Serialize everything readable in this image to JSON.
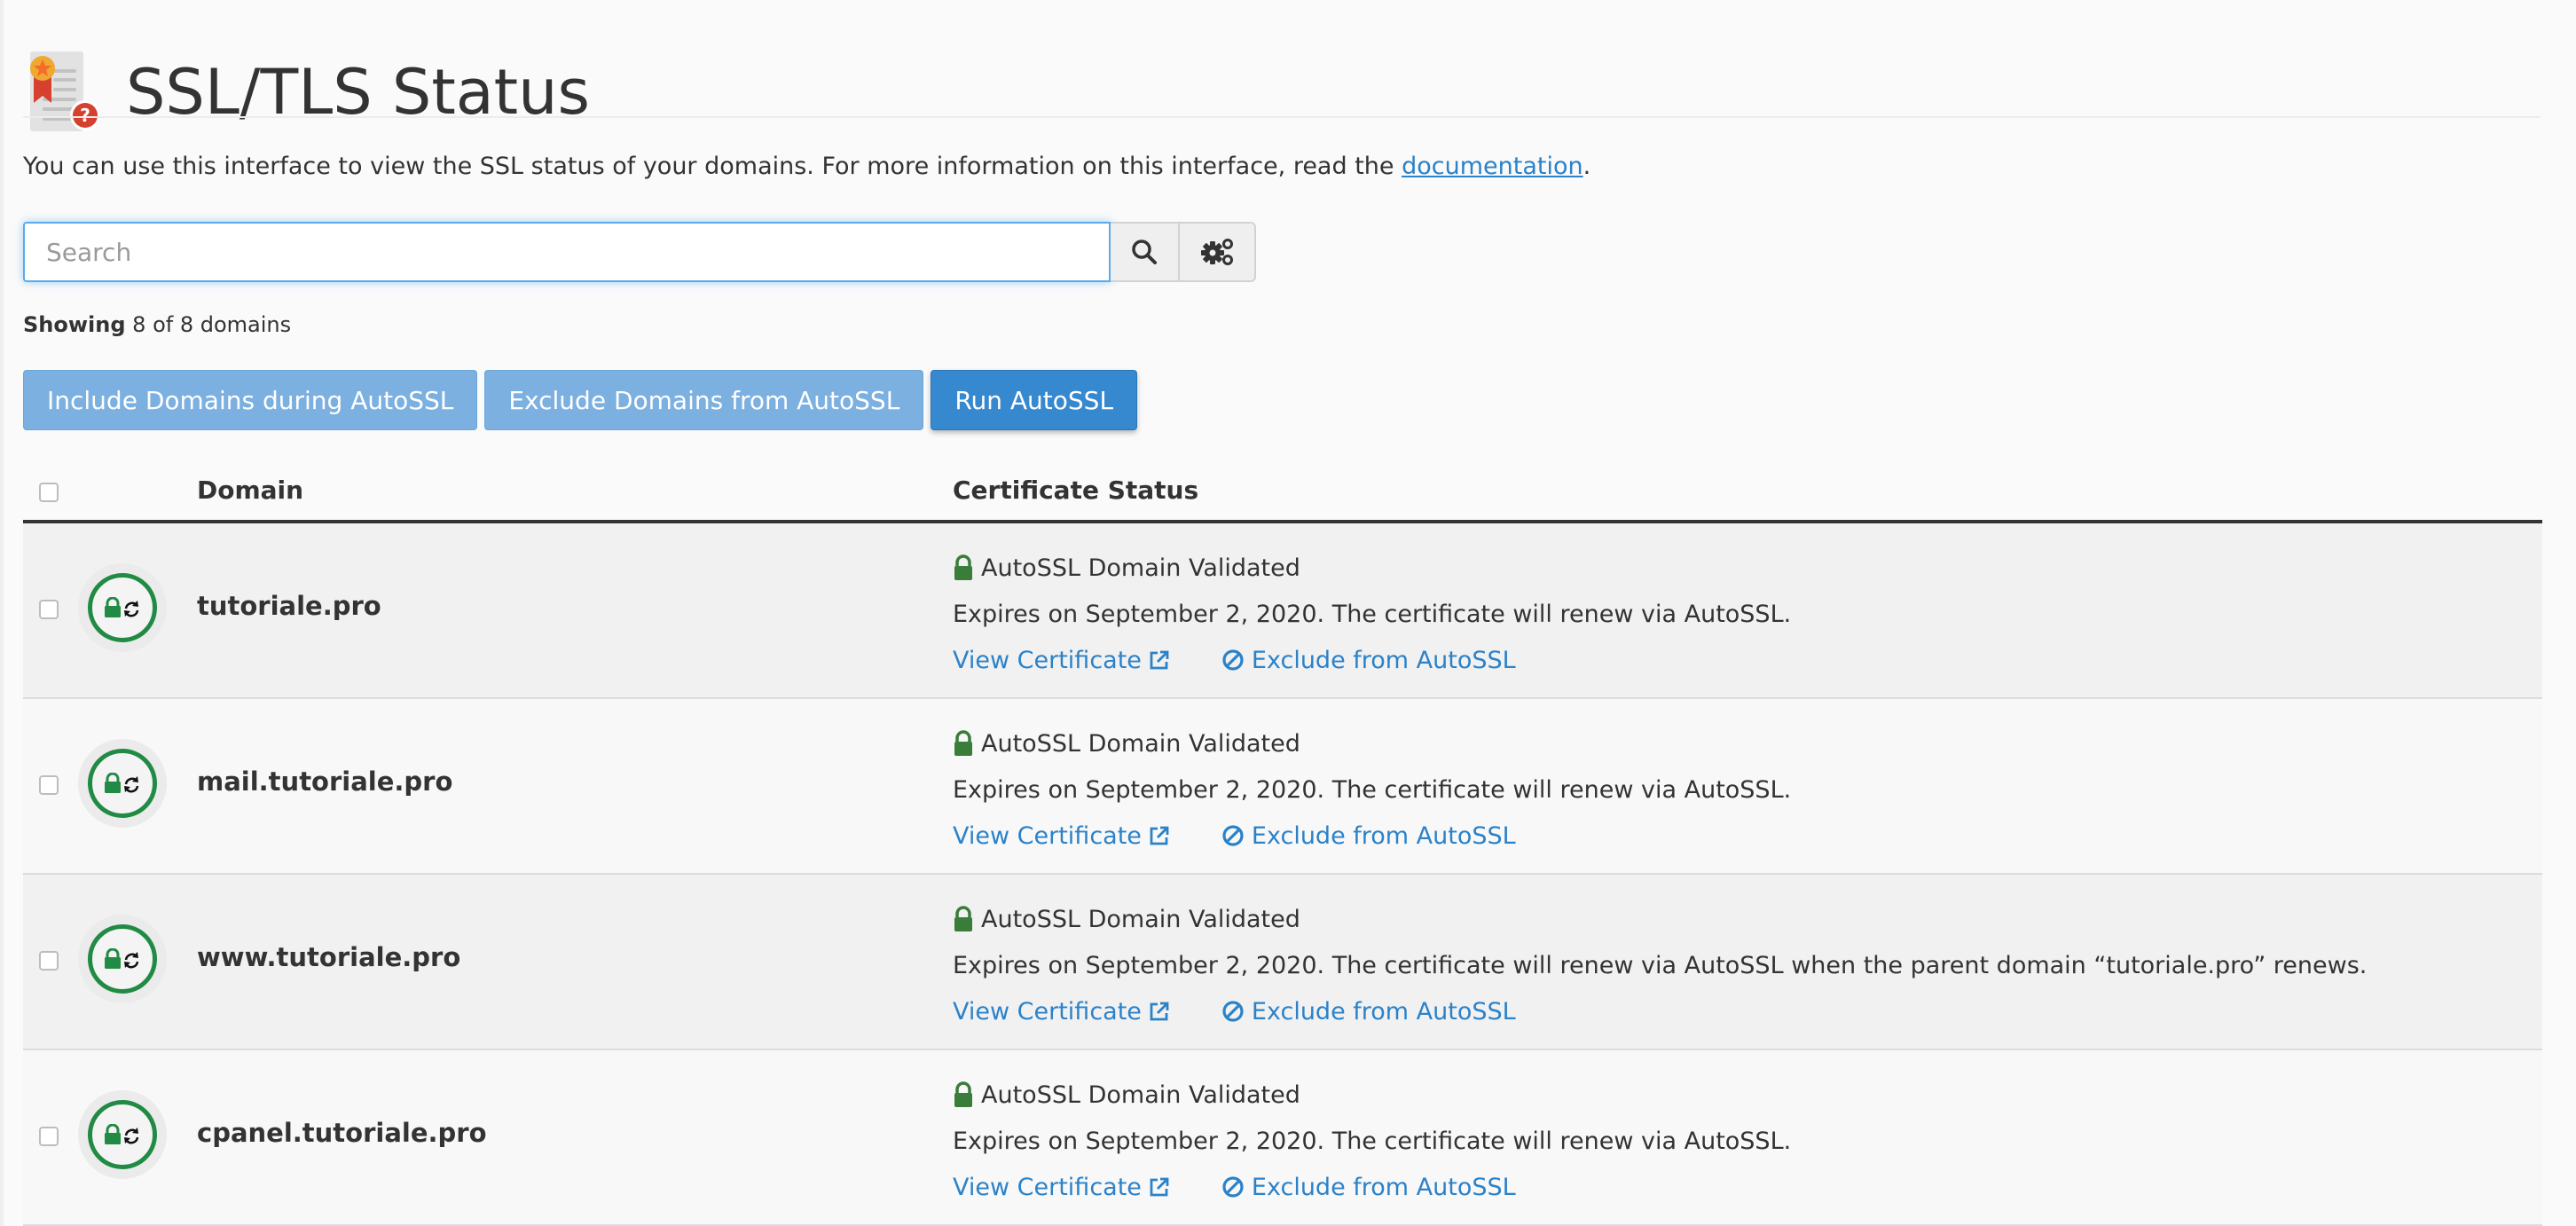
{
  "page": {
    "title": "SSL/TLS Status",
    "icon": "ssl-certificate-question-icon",
    "description_prefix": "You can use this interface to view the SSL status of your domains. For more information on this interface, read the ",
    "description_link": "documentation",
    "description_suffix": "."
  },
  "search": {
    "placeholder": "Search",
    "value": "",
    "search_button_icon": "search-icon",
    "settings_button_icon": "gears-icon"
  },
  "showing": {
    "label": "Showing",
    "text": "8 of 8 domains"
  },
  "actions": {
    "include": "Include Domains during AutoSSL",
    "exclude": "Exclude Domains from AutoSSL",
    "run": "Run AutoSSL"
  },
  "table": {
    "columns": [
      "Domain",
      "Certificate Status"
    ],
    "rows": [
      {
        "domain": "tutoriale.pro",
        "status": "AutoSSL Domain Validated",
        "details": "Expires on September 2, 2020. The certificate will renew via AutoSSL.",
        "view_link": "View Certificate",
        "exclude_link": "Exclude from AutoSSL"
      },
      {
        "domain": "mail.tutoriale.pro",
        "status": "AutoSSL Domain Validated",
        "details": "Expires on September 2, 2020. The certificate will renew via AutoSSL.",
        "view_link": "View Certificate",
        "exclude_link": "Exclude from AutoSSL"
      },
      {
        "domain": "www.tutoriale.pro",
        "status": "AutoSSL Domain Validated",
        "details": "Expires on September 2, 2020. The certificate will renew via AutoSSL when the parent domain “tutoriale.pro” renews.",
        "view_link": "View Certificate",
        "exclude_link": "Exclude from AutoSSL"
      },
      {
        "domain": "cpanel.tutoriale.pro",
        "status": "AutoSSL Domain Validated",
        "details": "Expires on September 2, 2020. The certificate will renew via AutoSSL.",
        "view_link": "View Certificate",
        "exclude_link": "Exclude from AutoSSL"
      }
    ]
  },
  "colors": {
    "link": "#2b82c9",
    "primary_button": "#3688cf",
    "light_button": "#7bb0e0",
    "valid_green": "#218a44"
  }
}
